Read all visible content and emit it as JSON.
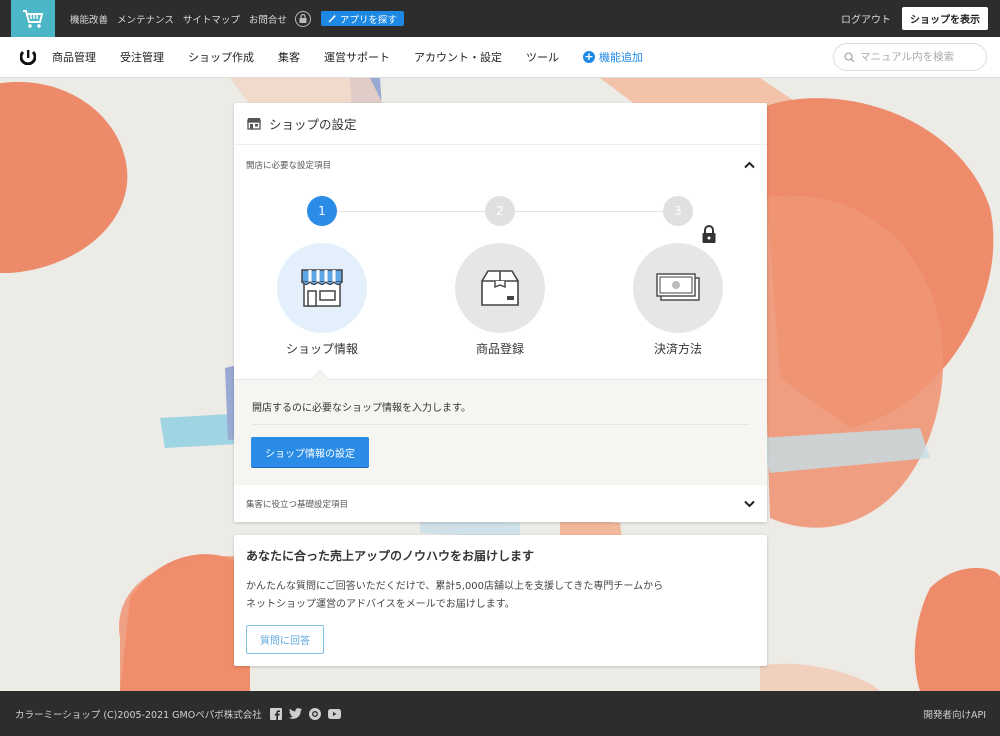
{
  "topbar": {
    "links": [
      "機能改善",
      "メンテナンス",
      "サイトマップ",
      "お問合せ"
    ],
    "app_button": "アプリを探す",
    "logout": "ログアウト",
    "view_shop": "ショップを表示"
  },
  "nav": {
    "items": [
      "商品管理",
      "受注管理",
      "ショップ作成",
      "集客",
      "運営サポート",
      "アカウント・設定",
      "ツール"
    ],
    "add_feature": "機能追加",
    "search_placeholder": "マニュアル内を検索"
  },
  "shop_settings": {
    "title": "ショップの設定",
    "section1": "開店に必要な設定項目",
    "steps": [
      {
        "number": "1",
        "label": "ショップ情報",
        "state": "active"
      },
      {
        "number": "2",
        "label": "商品登録",
        "state": "inactive"
      },
      {
        "number": "3",
        "label": "決済方法",
        "state": "locked"
      }
    ],
    "detail_text": "開店するのに必要なショップ情報を入力します。",
    "detail_button": "ショップ情報の設定",
    "section2": "集客に役立つ基礎設定項目"
  },
  "knowhow": {
    "title": "あなたに合った売上アップのノウハウをお届けします",
    "line1": "かんたんな質問にご回答いただくだけで、累計5,000店舗以上を支援してきた専門チームから",
    "line2": "ネットショップ運営のアドバイスをメールでお届けします。",
    "button": "質問に回答"
  },
  "footer": {
    "copyright": "カラーミーショップ (C)2005-2021 GMOペパボ株式会社",
    "api": "開発者向けAPI"
  },
  "colors": {
    "accent": "#2a8ce6",
    "topbar": "#2d2d2d",
    "logo_bg": "#4bb7c6",
    "step_inactive": "#e0e0e0"
  }
}
